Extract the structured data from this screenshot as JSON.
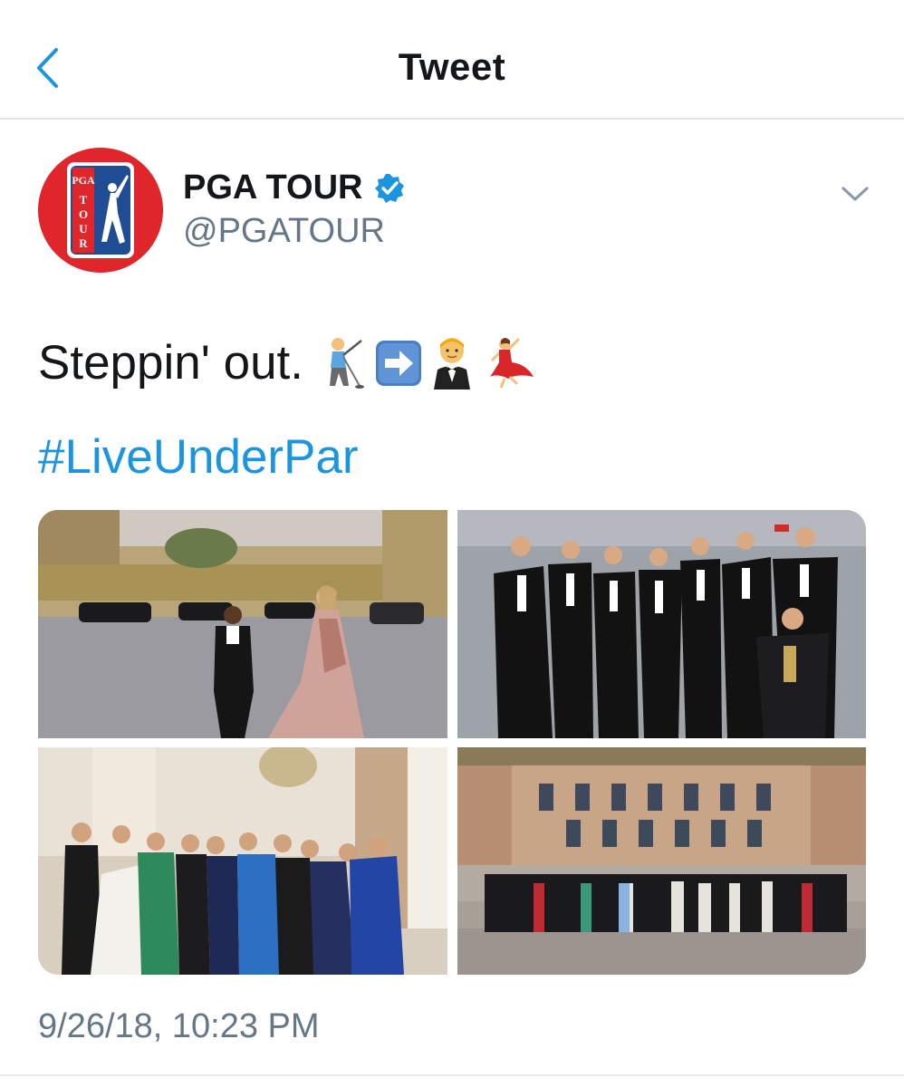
{
  "navbar": {
    "title": "Tweet",
    "back_icon": "chevron-left-icon"
  },
  "author": {
    "display_name": "PGA TOUR",
    "handle": "@PGATOUR",
    "verified": true,
    "avatar_logo_text": "PGA TOUR"
  },
  "tweet": {
    "text": "Steppin' out.",
    "emojis": [
      "golfer-emoji",
      "right-arrow-emoji",
      "man-in-tuxedo-emoji",
      "dancer-emoji"
    ],
    "hashtag": "#LiveUnderPar",
    "timestamp": "9/26/18, 10:23 PM"
  },
  "media": {
    "photos": [
      {
        "id": "photo-1",
        "subject": "couple-taking-photo-at-palace"
      },
      {
        "id": "photo-2",
        "subject": "golfers-taking-selfies"
      },
      {
        "id": "photo-3",
        "subject": "group-in-gowns-indoors"
      },
      {
        "id": "photo-4",
        "subject": "group-photo-palace-courtyard"
      }
    ]
  },
  "colors": {
    "accent": "#1b95e0",
    "text": "#14171a",
    "secondary": "#657786",
    "avatar_red": "#e0262a",
    "logo_blue": "#1f4c92"
  }
}
